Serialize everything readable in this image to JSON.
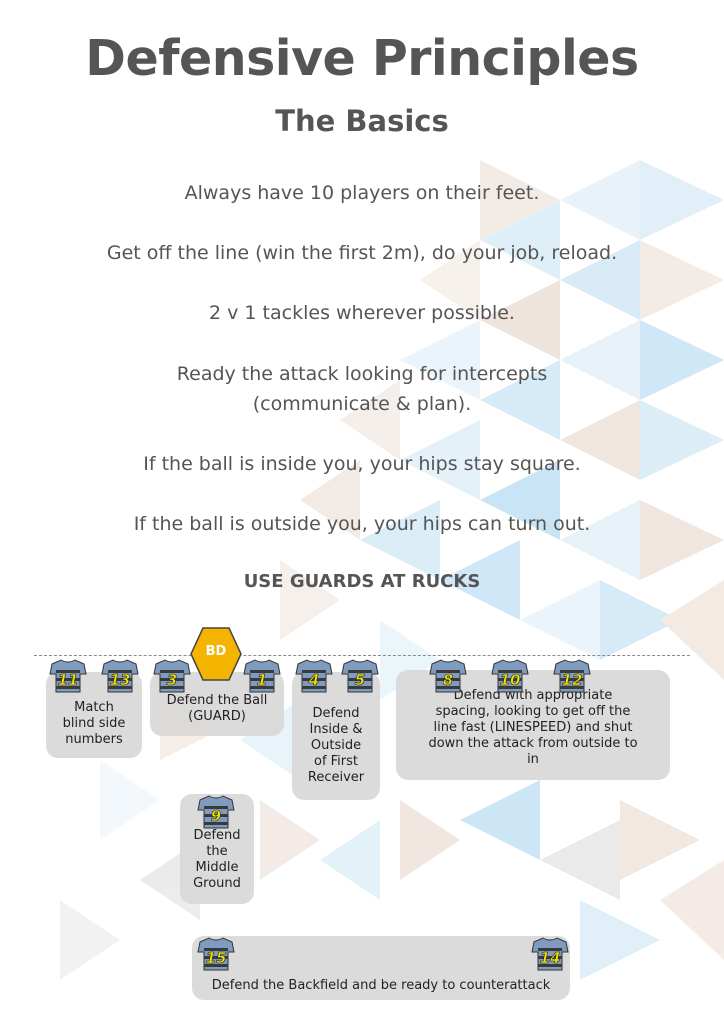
{
  "header": {
    "title": "Defensive Principles",
    "subtitle": "The Basics"
  },
  "principles": [
    "Always have 10 players on their feet.",
    "Get off the line (win the first 2m), do your job, reload.",
    "2 v 1 tackles wherever possible.",
    "Ready the attack looking for intercepts",
    "(communicate & plan).",
    "If the ball is inside you, your hips stay square.",
    "If the ball is outside you, your hips can turn out."
  ],
  "guards_heading": "USE GUARDS AT RUCKS",
  "breakdown": {
    "label": "BD",
    "color": "#f4b400"
  },
  "players": {
    "p11": "11",
    "p13": "13",
    "p3": "3",
    "p1": "1",
    "p4": "4",
    "p5": "5",
    "p8": "8",
    "p10": "10",
    "p12": "12",
    "p9": "9",
    "p15": "15",
    "p14": "14"
  },
  "roles": {
    "wingers": [
      "Match",
      "blind side",
      "numbers"
    ],
    "guard": [
      "Defend the Ball",
      "(GUARD)"
    ],
    "first_receiver": [
      "Defend",
      "Inside &",
      "Outside",
      "of First",
      "Receiver"
    ],
    "outside_line": [
      "Defend with appropriate",
      "spacing, looking to get off the",
      "line fast (LINESPEED) and shut",
      "down the attack from outside to",
      "in"
    ],
    "middle": [
      "Defend",
      "the",
      "Middle",
      "Ground"
    ],
    "backfield": "Defend the Backfield and be ready to counterattack"
  },
  "colors": {
    "text": "#555555",
    "shirt_blue": "#7f9bbf",
    "shirt_stripe": "#3a3a3a",
    "number_yellow": "#f2e600",
    "box_gray": "#d8d8d8"
  }
}
